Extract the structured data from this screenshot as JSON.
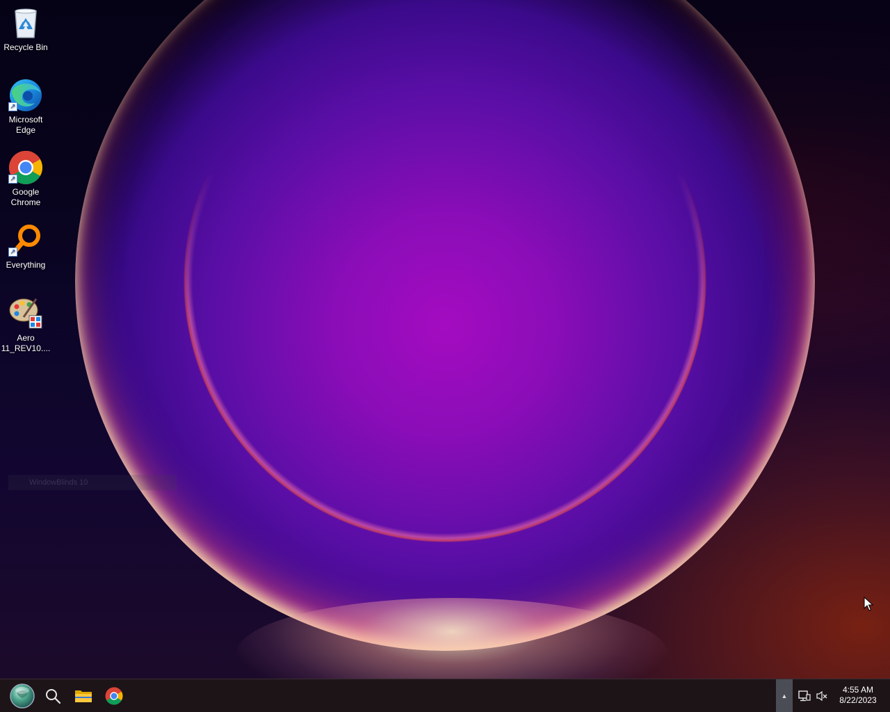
{
  "desktop": {
    "icons": [
      {
        "label": "Recycle Bin",
        "icon": "recycle-bin-icon"
      },
      {
        "label": "Microsoft Edge",
        "icon": "edge-icon",
        "shortcut": true
      },
      {
        "label": "Google Chrome",
        "icon": "chrome-icon",
        "shortcut": true
      },
      {
        "label": "Everything",
        "icon": "everything-search-icon",
        "shortcut": true
      },
      {
        "label": "Aero 11_REV10....",
        "icon": "paint-palette-icon"
      }
    ],
    "ghost_window_label": "WindowBlinds 10"
  },
  "taskbar": {
    "start": "start-orb-icon",
    "pinned": [
      "search-icon",
      "file-explorer-icon",
      "chrome-icon"
    ],
    "tray_expand": "▲",
    "tray_icons": [
      "network-icon",
      "volume-muted-icon"
    ],
    "clock": {
      "time": "4:55 AM",
      "date": "8/22/2023"
    }
  },
  "colors": {
    "taskbar_bg": "#1d1418",
    "tray_expand_bg": "#4a4d55",
    "orb_core": "#a40cc0"
  }
}
